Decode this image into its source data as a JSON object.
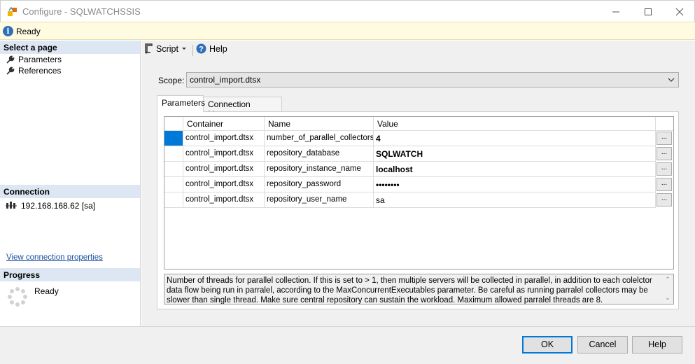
{
  "window": {
    "title": "Configure - SQLWATCHSSIS"
  },
  "status_bar": {
    "text": "Ready"
  },
  "left_pane": {
    "select_page_header": "Select a page",
    "pages": [
      {
        "label": "Parameters"
      },
      {
        "label": "References"
      }
    ],
    "connection_header": "Connection",
    "connection_value": "192.168.168.62 [sa]",
    "view_connection_link": "View connection properties",
    "progress_header": "Progress",
    "progress_status": "Ready"
  },
  "toolbar": {
    "script_label": "Script",
    "help_label": "Help"
  },
  "scope": {
    "label": "Scope:",
    "value": "control_import.dtsx"
  },
  "tabs": [
    {
      "label": "Parameters",
      "active": true
    },
    {
      "label": "Connection Managers",
      "active": false
    }
  ],
  "grid": {
    "columns": [
      "Container",
      "Name",
      "Value"
    ],
    "rows": [
      {
        "container": "control_import.dtsx",
        "name": "number_of_parallel_collectors",
        "value": "4",
        "bold": true,
        "ellipsis": "..."
      },
      {
        "container": "control_import.dtsx",
        "name": "repository_database",
        "value": "SQLWATCH",
        "bold": true,
        "ellipsis": "..."
      },
      {
        "container": "control_import.dtsx",
        "name": "repository_instance_name",
        "value": "localhost",
        "bold": true,
        "ellipsis": "..."
      },
      {
        "container": "control_import.dtsx",
        "name": "repository_password",
        "value": "••••••••",
        "bold": true,
        "ellipsis": "..."
      },
      {
        "container": "control_import.dtsx",
        "name": "repository_user_name",
        "value": "sa",
        "bold": false,
        "ellipsis": "..."
      }
    ]
  },
  "description": "Number of threads for parallel collection. If this is set to > 1, then multiple servers will be collected in parallel, in addition to each colelctor data flow being run in parralel, according to the MaxConcurrentExecutables parameter. Be careful as running parralel collectors may be slower than single thread. Make sure central repository can sustain the workload. Maximum allowed parralel threads are 8.",
  "buttons": {
    "ok": "OK",
    "cancel": "Cancel",
    "help": "Help"
  },
  "colors": {
    "accent": "#0078d7",
    "status_bar_bg": "#fffbe0",
    "section_header_bg": "#dde7f3",
    "link": "#1b4fa0"
  },
  "icons": {
    "app": "ssis-package-icon",
    "status": "info-icon",
    "page": "wrench-icon",
    "connection": "server-connection-icon",
    "progress": "spinner-icon",
    "script": "script-icon",
    "help": "help-icon"
  }
}
